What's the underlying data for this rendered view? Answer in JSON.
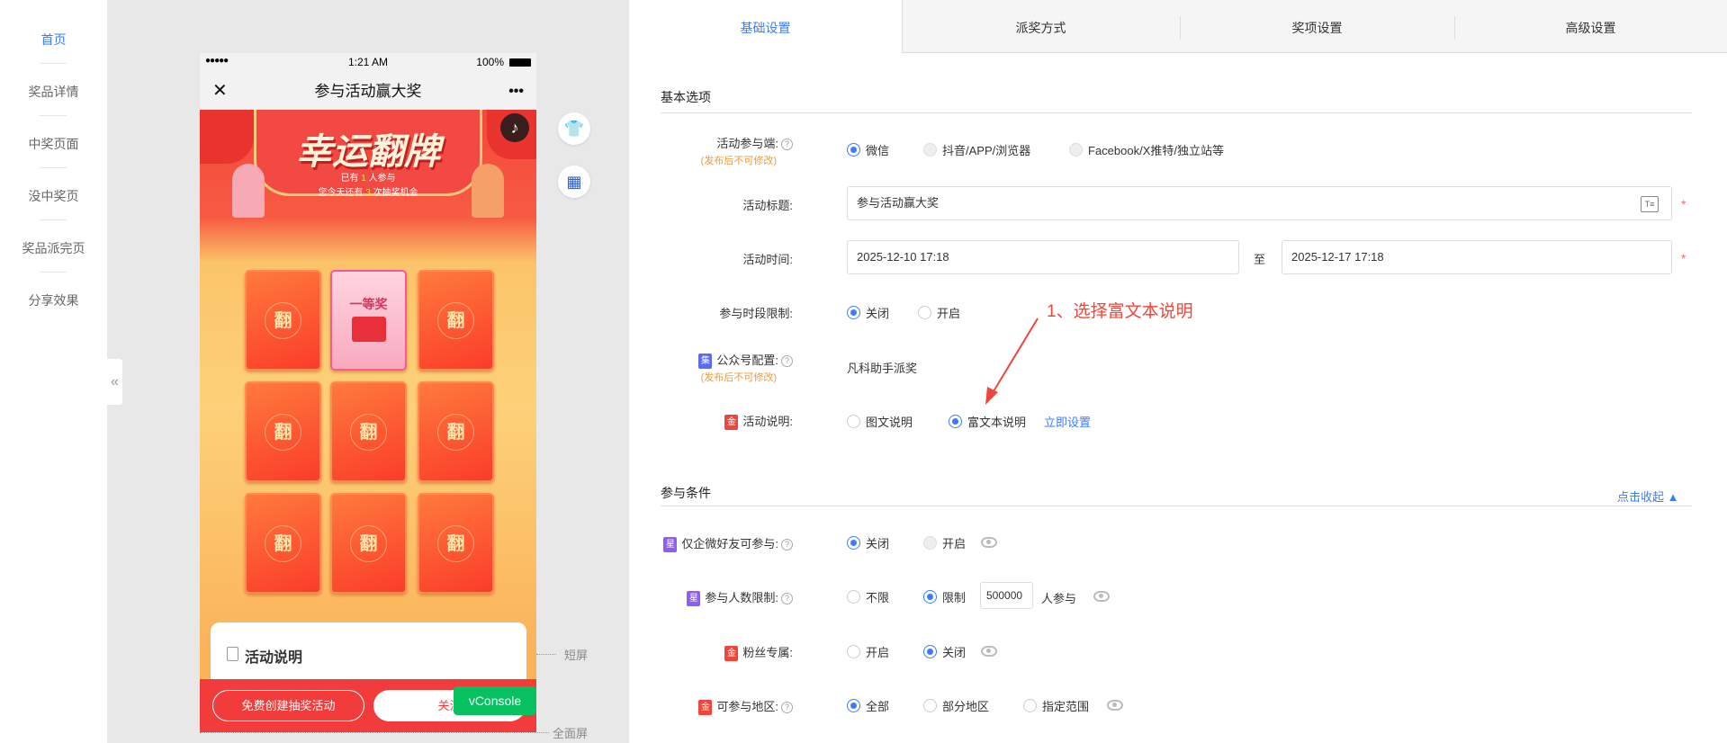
{
  "sidebar": {
    "items": [
      {
        "label": "首页"
      },
      {
        "label": "奖品详情"
      },
      {
        "label": "中奖页面"
      },
      {
        "label": "没中奖页"
      },
      {
        "label": "奖品派完页"
      },
      {
        "label": "分享效果"
      }
    ],
    "collapse": "«"
  },
  "phone": {
    "signal": "●●●●●",
    "time": "1:21 AM",
    "battery": "100%",
    "close": "✕",
    "title": "参与活动赢大奖",
    "more": "•••",
    "banner_title": "幸运翻牌",
    "joined_prefix": "已有",
    "joined_count": "1",
    "joined_suffix": "人参与",
    "chances_prefix": "您今天还有",
    "chances_count": "3",
    "chances_suffix": "次抽奖机会",
    "card_label": "翻",
    "prize_label": "一等奖",
    "desc_title": "活动说明",
    "btn_create": "免费创建抽奖活动",
    "btn_follow": "关注",
    "vconsole": "vConsole",
    "short_screen": "短屏",
    "full_screen": "全面屏"
  },
  "tabs": [
    {
      "label": "基础设置"
    },
    {
      "label": "派奖方式"
    },
    {
      "label": "奖项设置"
    },
    {
      "label": "高级设置"
    }
  ],
  "basic": {
    "title": "基本选项",
    "platform": {
      "label": "活动参与端:",
      "note": "(发布后不可修改)",
      "options": [
        "微信",
        "抖音/APP/浏览器",
        "Facebook/X推特/独立站等"
      ]
    },
    "title_field": {
      "label": "活动标题:",
      "value": "参与活动赢大奖"
    },
    "time": {
      "label": "活动时间:",
      "start": "2025-12-10 17:18",
      "sep": "至",
      "end": "2025-12-17 17:18"
    },
    "period": {
      "label": "参与时段限制:",
      "options": [
        "关闭",
        "开启"
      ]
    },
    "account": {
      "badge": "集",
      "label": "公众号配置:",
      "note": "(发布后不可修改)",
      "value": "凡科助手派奖"
    },
    "desc": {
      "badge": "金",
      "label": "活动说明:",
      "options": [
        "图文说明",
        "富文本说明"
      ],
      "link": "立即设置"
    },
    "annotation": "1、选择富文本说明"
  },
  "conditions": {
    "title": "参与条件",
    "collapse": "点击收起 ▲",
    "wecom": {
      "badge": "星",
      "label": "仅企微好友可参与:",
      "options": [
        "关闭",
        "开启"
      ]
    },
    "limit": {
      "badge": "星",
      "label": "参与人数限制:",
      "options": [
        "不限",
        "限制"
      ],
      "value": "500000",
      "suffix": "人参与"
    },
    "fans": {
      "badge": "金",
      "label": "粉丝专属:",
      "options": [
        "开启",
        "关闭"
      ]
    },
    "region": {
      "badge": "金",
      "label": "可参与地区:",
      "options": [
        "全部",
        "部分地区",
        "指定范围"
      ]
    }
  },
  "colors": {
    "accent": "#3b7cff",
    "required": "#f56c6c",
    "note": "#f09a3e"
  }
}
